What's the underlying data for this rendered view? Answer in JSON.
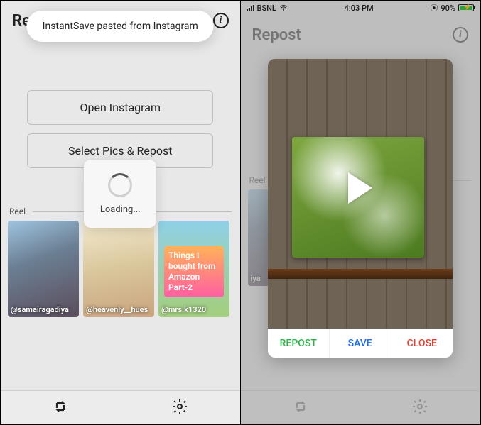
{
  "left": {
    "title": "Repost",
    "toast": "InstantSave pasted from Instagram",
    "btn_open": "Open Instagram",
    "btn_select": "Select Pics & Repost",
    "section": "Reel",
    "loading": "Loading...",
    "thumbs": [
      {
        "handle": "@samairagadiya"
      },
      {
        "handle": "@heavenly__hues"
      },
      {
        "handle": "@mrs.k1320",
        "caption": "Things I bought from Amazon Part-2"
      }
    ]
  },
  "status": {
    "carrier": "BSNL",
    "time": "4:03 PM",
    "battery_pct": "90%"
  },
  "right": {
    "title": "Repost",
    "section": "Reel",
    "thumb_handle_partial": "iya",
    "actions": {
      "repost": "REPOST",
      "save": "SAVE",
      "close": "CLOSE"
    }
  }
}
